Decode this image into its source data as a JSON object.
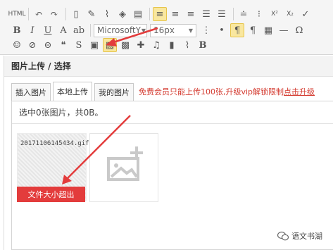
{
  "toolbar": {
    "font_family": "MicrosoftY",
    "font_size": "16px",
    "html_label": "HTML",
    "bold": "B",
    "italic": "I",
    "underline": "U",
    "font_color": "A",
    "last_b": "B",
    "omega": "Ω",
    "superscript": "X²",
    "subscript": "X₂"
  },
  "dialog": {
    "title": "图片上传 / 选择",
    "tabs": [
      {
        "label": "插入图片"
      },
      {
        "label": "本地上传"
      },
      {
        "label": "我的图片"
      }
    ],
    "notice_text": "免费会员只能上传100张,升级vip解锁限制",
    "notice_link": "点击升级",
    "selection_info": "选中0张图片，共0B。",
    "file": {
      "name": "20171106145434.gif",
      "error": "文件大小超出"
    }
  },
  "watermark": "语文书湖",
  "colors": {
    "accent_red": "#e33c3c",
    "notice_red": "#d43b30",
    "active_button": "#f9e79f"
  }
}
